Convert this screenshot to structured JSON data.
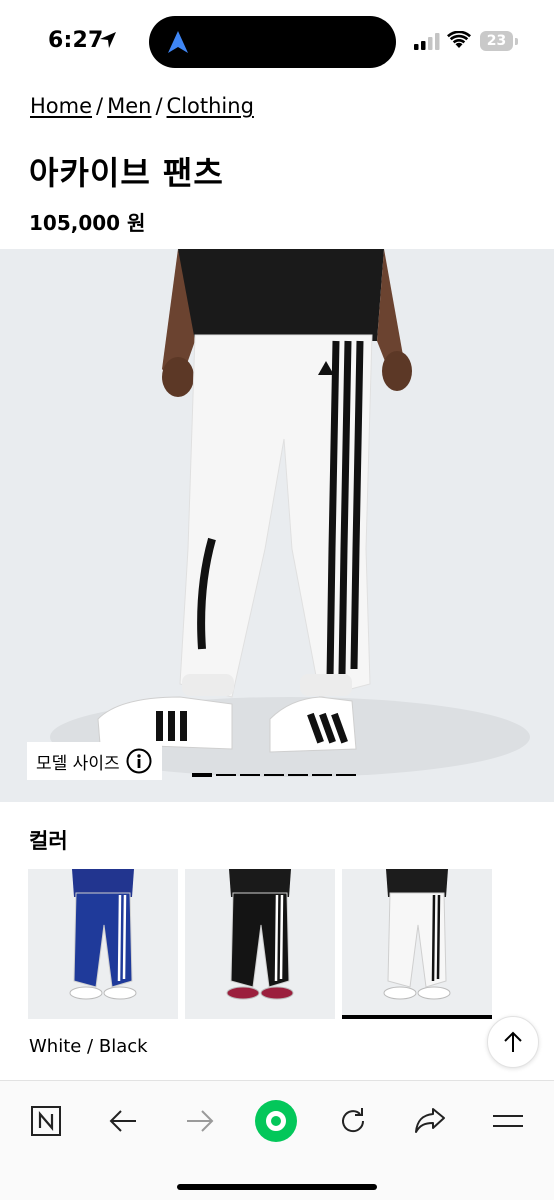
{
  "status_bar": {
    "time": "6:27",
    "battery": "23",
    "icons": [
      "location-arrow-icon",
      "signal-icon",
      "wifi-icon",
      "battery-icon"
    ]
  },
  "breadcrumb": {
    "items": [
      "Home",
      "Men",
      "Clothing"
    ],
    "separator": "/"
  },
  "product": {
    "title": "아카이브 팬츠",
    "price": "105,000 원"
  },
  "hero": {
    "model_size_label": "모델 사이즈",
    "slide_count": 7,
    "active_slide": 1
  },
  "colors": {
    "label": "컬러",
    "selected_name": "White / Black",
    "swatches": [
      {
        "name": "blue",
        "pants": "#1f3a9a",
        "top": "#22358f",
        "shoe": "#ffffff"
      },
      {
        "name": "black",
        "pants": "#141414",
        "top": "#1a1a1a",
        "shoe": "#9b1f3d"
      },
      {
        "name": "white",
        "pants": "#f7f7f7",
        "top": "#1c1c1c",
        "shoe": "#ffffff"
      }
    ],
    "selected_index": 2
  },
  "browser_bar": {
    "buttons": [
      "naver-logo-icon",
      "back-arrow-icon",
      "forward-arrow-icon",
      "green-circle-icon",
      "refresh-icon",
      "share-icon",
      "menu-icon"
    ],
    "accent": "#03c75a"
  }
}
